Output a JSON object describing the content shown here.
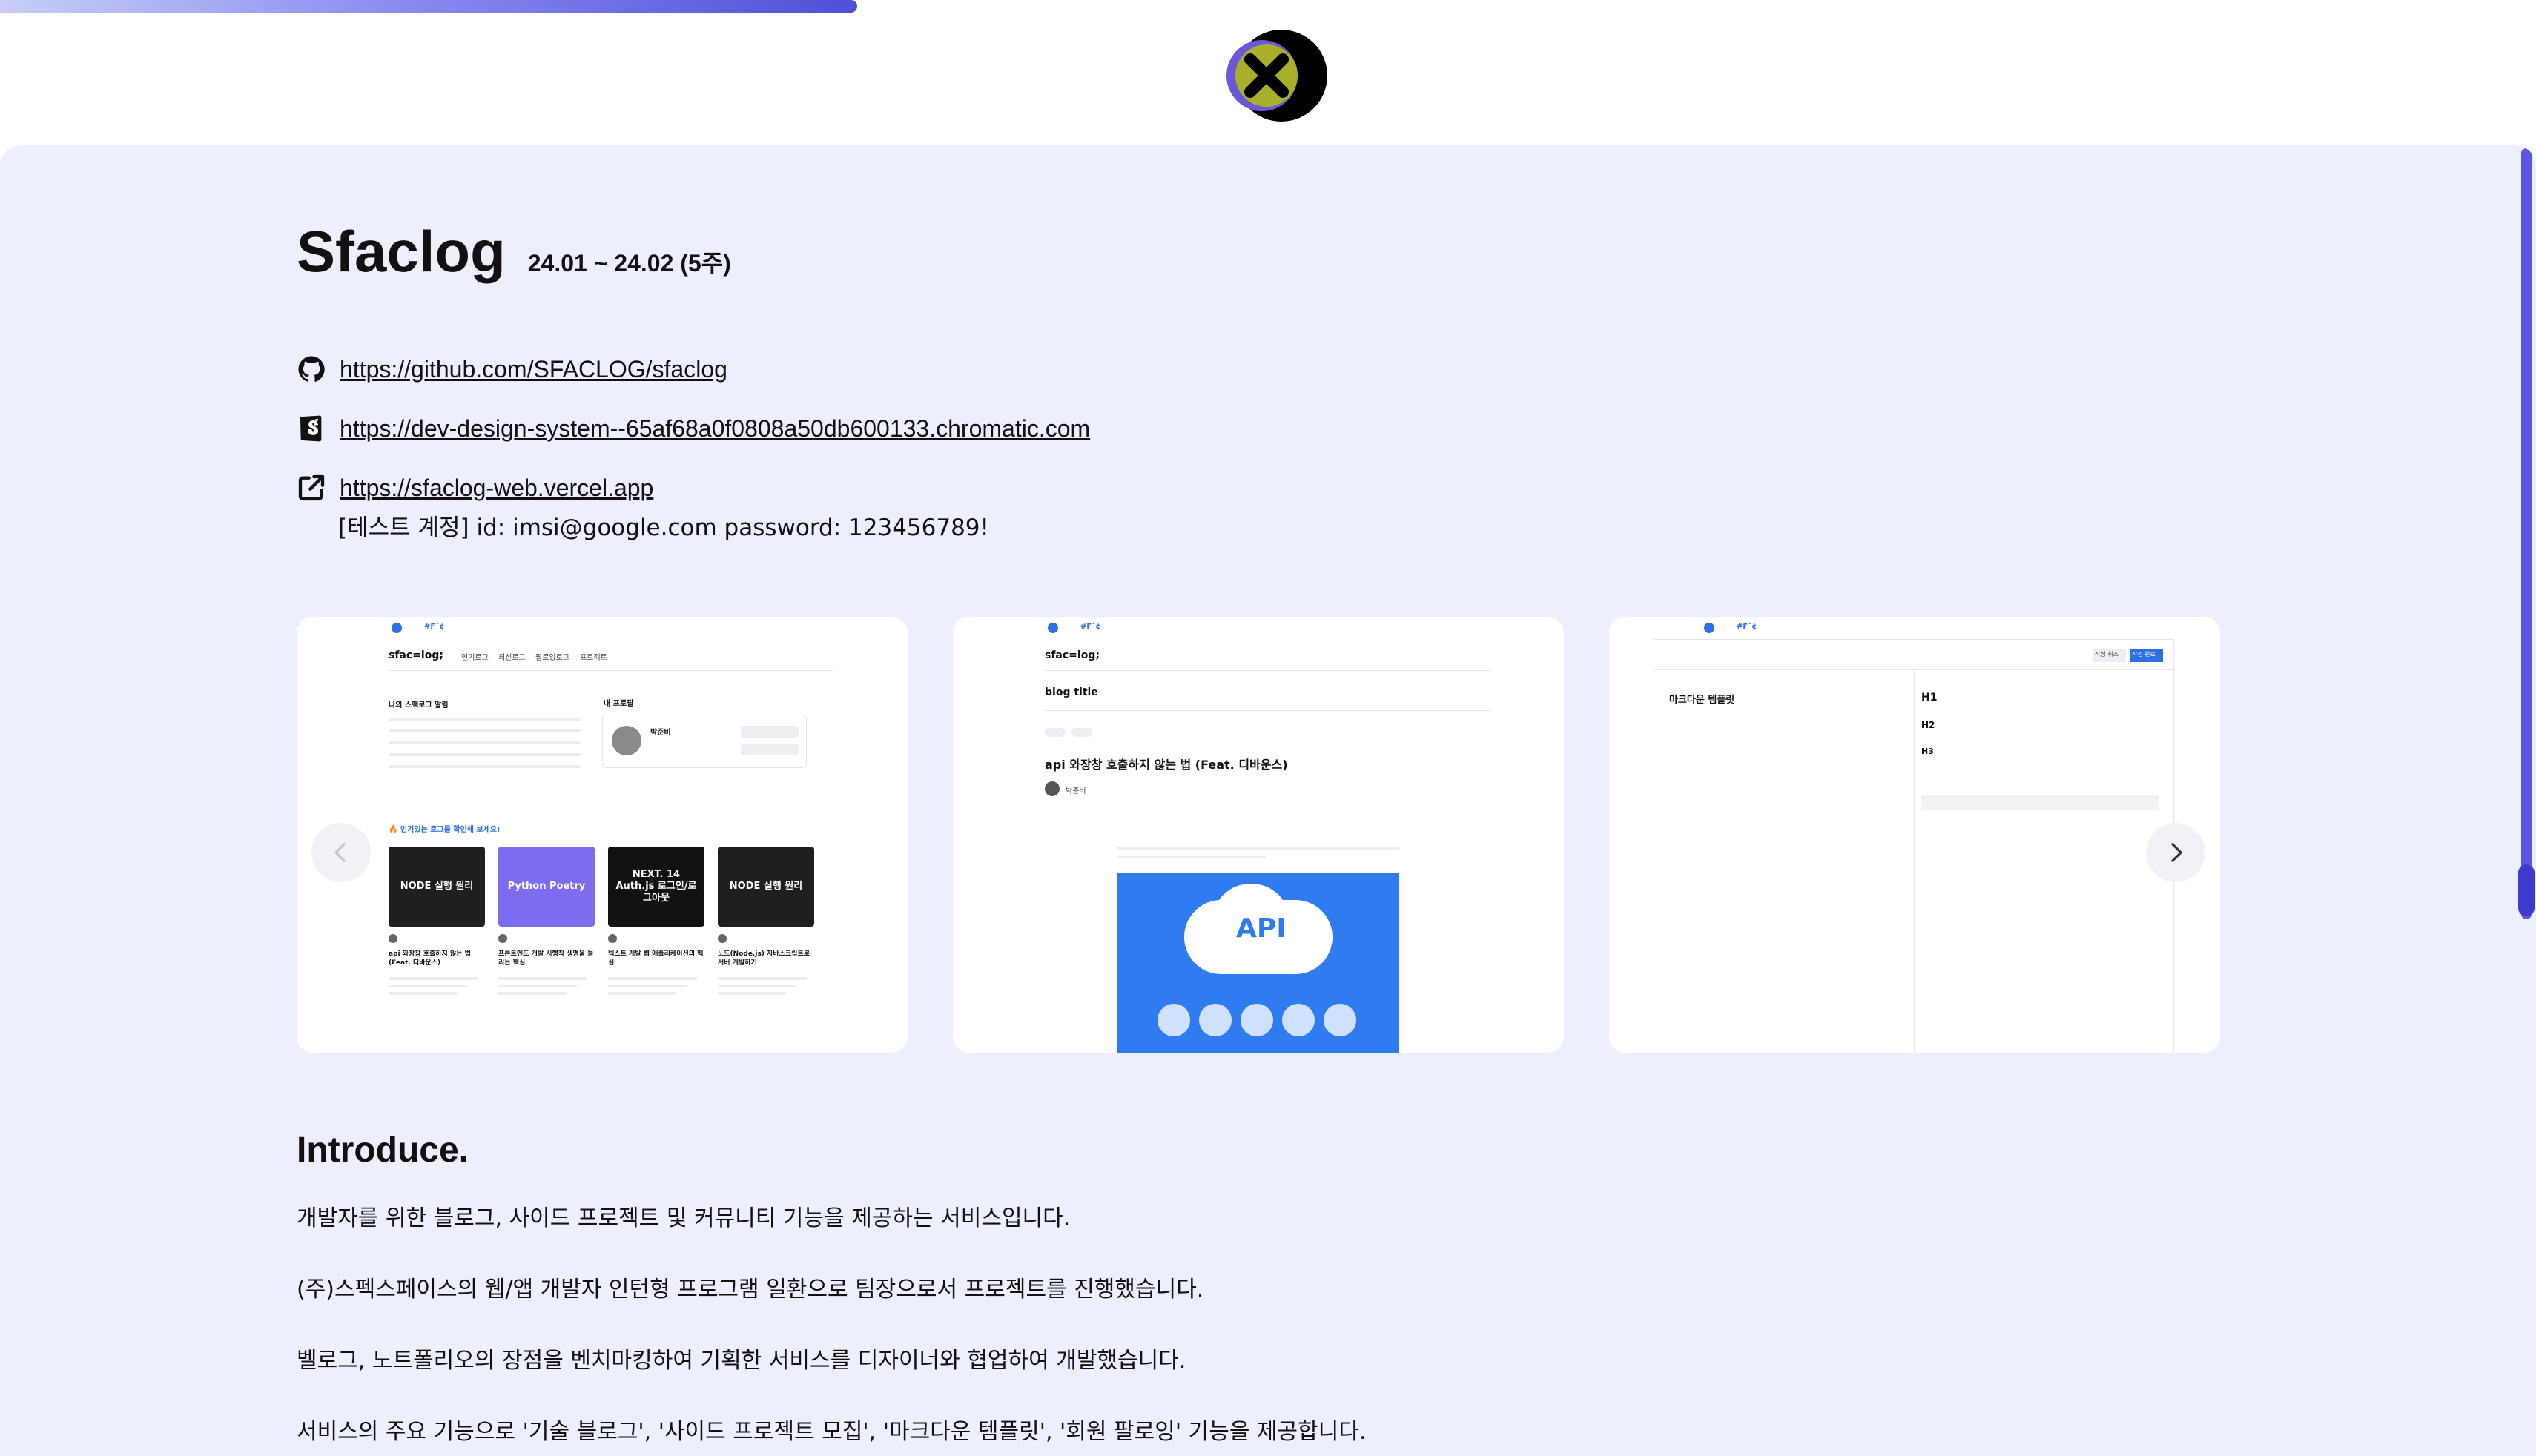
{
  "progress": {
    "fraction": 0.338
  },
  "close_button": {
    "icon": "close-icon",
    "colors": {
      "ring": "#000000",
      "accent": "#a8b02a",
      "accent2": "#6b57d8"
    }
  },
  "project": {
    "title": "Sfaclog",
    "period": "24.01 ~ 24.02 (5주)"
  },
  "links": [
    {
      "icon": "github-icon",
      "text": "https://github.com/SFACLOG/sfaclog"
    },
    {
      "icon": "storybook-icon",
      "text": "https://dev-design-system--65af68a0f0808a50db600133.chromatic.com"
    },
    {
      "icon": "external-link-icon",
      "text": "https://sfaclog-web.vercel.app"
    }
  ],
  "test_account": "[테스트 계정] id: imsi@google.com password: 123456789!",
  "gallery": {
    "prev_icon": "chevron-left-icon",
    "next_icon": "chevron-right-icon",
    "slides": [
      {
        "name": "home",
        "brand": "sfac=log;",
        "menu": [
          "인기로그",
          "최신로그",
          "팔로잉로그",
          "프로젝트"
        ],
        "section": "🔥 인기있는 로그를 확인해 보세요!",
        "my_tier": "나의 스팩로그 알림",
        "profile_label": "내 프로필",
        "profile_name": "박준비",
        "cards": [
          {
            "thumb": "NODE 실행 원리",
            "color": "#1f1f1f",
            "title": "api 와장창 호출하지 않는 법 (Feat. 디바운스)"
          },
          {
            "thumb": "Python Poetry",
            "color": "#7c6cf0",
            "title": "프론트엔드 개발 시행착 생명을 늘리는 핵심"
          },
          {
            "thumb": "NEXT. 14 Auth.js 로그인/로그아웃",
            "color": "#111111",
            "title": "넥스트 개발 웹 애플리케이션의 핵심"
          },
          {
            "thumb": "NODE 실행 원리",
            "color": "#1f1f1f",
            "title": "노드(Node.js) 자바스크립트로 서버 개발하기"
          }
        ]
      },
      {
        "name": "post",
        "brand": "sfac=log;",
        "blog_title": "blog title",
        "post_title": "api 와장창 호출하지 않는 법 (Feat. 디바운스)",
        "author": "박준비",
        "image_text": "API"
      },
      {
        "name": "editor",
        "left_title": "마크다운 템플릿",
        "h1": "H1",
        "h2": "H2",
        "h3": "H3",
        "save_label": "작성 취소",
        "publish_label": "작성 완료"
      }
    ]
  },
  "introduce": {
    "heading": "Introduce.",
    "paragraphs": [
      "개발자를 위한 블로그, 사이드 프로젝트 및 커뮤니티 기능을 제공하는 서비스입니다.",
      "(주)스펙스페이스의 웹/앱 개발자 인턴형 프로그램 일환으로 팀장으로서 프로젝트를 진행했습니다.",
      "벨로그, 노트폴리오의 장점을 벤치마킹하여 기획한 서비스를 디자이너와 협업하여 개발했습니다.",
      "서비스의 주요 기능으로 '기술 블로그', '사이드 프로젝트 모집', '마크다운 템플릿', '회원 팔로잉' 기능을 제공합니다."
    ]
  },
  "colors": {
    "sheet": "#edf0fc",
    "scrollbar": "#5b57e0",
    "accent_blue": "#2f6fe6"
  }
}
